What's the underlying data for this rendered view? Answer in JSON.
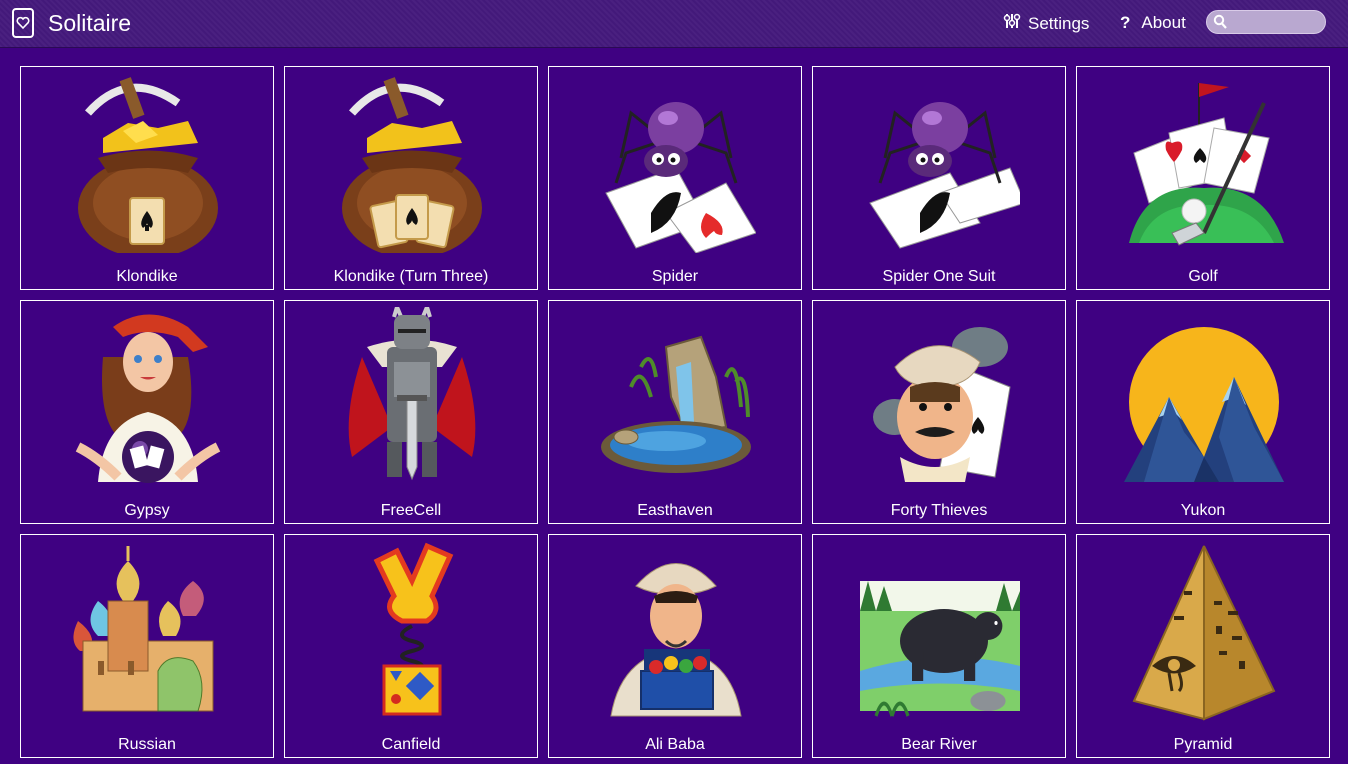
{
  "header": {
    "title": "Solitaire",
    "settings_label": "Settings",
    "about_label": "About",
    "search_placeholder": ""
  },
  "games": [
    {
      "label": "Klondike",
      "icon": "klondike-gold-sack-icon"
    },
    {
      "label": "Klondike (Turn Three)",
      "icon": "klondike-three-gold-sack-icon"
    },
    {
      "label": "Spider",
      "icon": "spider-cards-icon"
    },
    {
      "label": "Spider One Suit",
      "icon": "spider-one-suit-icon"
    },
    {
      "label": "Golf",
      "icon": "golf-cards-icon"
    },
    {
      "label": "Gypsy",
      "icon": "gypsy-fortune-teller-icon"
    },
    {
      "label": "FreeCell",
      "icon": "freecell-knight-icon"
    },
    {
      "label": "Easthaven",
      "icon": "waterfall-pond-icon"
    },
    {
      "label": "Forty Thieves",
      "icon": "forty-thieves-icon"
    },
    {
      "label": "Yukon",
      "icon": "mountains-sun-icon"
    },
    {
      "label": "Russian",
      "icon": "onion-domes-icon"
    },
    {
      "label": "Canfield",
      "icon": "jack-in-the-box-icon"
    },
    {
      "label": "Ali Baba",
      "icon": "ali-baba-treasure-icon"
    },
    {
      "label": "Bear River",
      "icon": "bear-river-icon"
    },
    {
      "label": "Pyramid",
      "icon": "golden-pyramid-icon"
    }
  ],
  "colors": {
    "background": "#3f0182",
    "header": "#4a2080",
    "tile_border": "#ffffff",
    "text": "#ffffff"
  }
}
